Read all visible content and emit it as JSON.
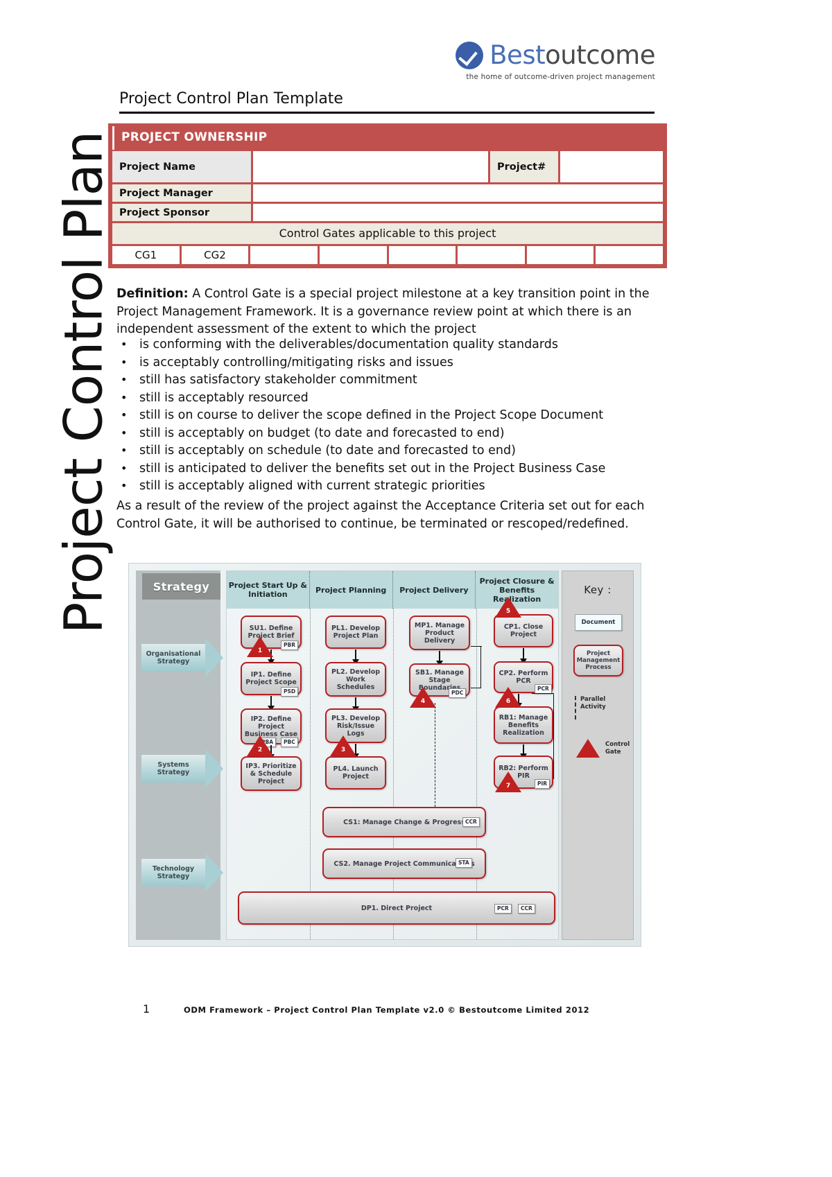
{
  "side_title": "Project Control Plan",
  "logo": {
    "mark": "check-circle-icon",
    "word_first": "Best",
    "word_second": "outcome",
    "tagline": "the home of outcome-driven project management"
  },
  "doc_title": "Project Control Plan Template",
  "ownership": {
    "banner": "PROJECT OWNERSHIP",
    "rows": [
      {
        "label": "Project Name",
        "value": "",
        "label2": "Project#",
        "value2": ""
      },
      {
        "label": "Project Manager",
        "value": ""
      },
      {
        "label": "Project Sponsor",
        "value": ""
      }
    ],
    "gates_caption": "Control Gates applicable to this project",
    "gate_cells": [
      "CG1",
      "CG2",
      "",
      "",
      "",
      "",
      "",
      ""
    ]
  },
  "definition": {
    "lead_label": "Definition:",
    "lead_text": " A Control Gate is a special project milestone at a key transition point in the Project Management Framework. It is a governance review point at which there is an independent assessment of the extent to which the project"
  },
  "bullets": [
    "is conforming with the deliverables/documentation quality standards",
    "is acceptably controlling/mitigating risks and issues",
    "still has satisfactory stakeholder commitment",
    "still is acceptably resourced",
    "still is on course to deliver the scope defined in the Project Scope Document",
    "still is acceptably on budget (to date and forecasted to end)",
    "still is acceptably on schedule (to date and forecasted to end)",
    "still is anticipated to deliver the benefits set out in the Project Business Case",
    "still is acceptably aligned with current strategic priorities"
  ],
  "closing": "As a result of the review of the project against the Acceptance Criteria set out for each Control Gate, it will be authorised to continue, be terminated or rescoped/redefined.",
  "diagram": {
    "strategy_header": "Strategy",
    "strategy_lanes": [
      "Organisational Strategy",
      "Systems Strategy",
      "Technology Strategy"
    ],
    "columns": [
      "Project Start Up & Initiation",
      "Project Planning",
      "Project Delivery",
      "Project Closure & Benefits Realization"
    ],
    "boxes": {
      "su1": "SU1. Define Project Brief",
      "ip1": "IP1. Define Project Scope",
      "ip2": "IP2. Define Project Business Case",
      "ip3": "IP3. Prioritize & Schedule Project",
      "pl1": "PL1. Develop Project Plan",
      "pl2": "PL2. Develop Work Schedules",
      "pl3": "PL3. Develop Risk/Issue Logs",
      "pl4": "PL4. Launch Project",
      "mp1": "MP1. Manage Product Delivery",
      "sb1": "SB1. Manage Stage Boundaries",
      "cp1": "CP1. Close Project",
      "cp2": "CP2. Perform PCR",
      "rb1": "RB1: Manage Benefits Realization",
      "rb2": "RB2: Perform PIR",
      "cs1": "CS1: Manage Change & Progress",
      "cs2": "CS2. Manage Project Communications",
      "dp1": "DP1. Direct Project"
    },
    "doc_tags": {
      "pbr": "PBR",
      "psd": "PSD",
      "pba": "PBA",
      "pbc": "PBC",
      "pdc": "PDC",
      "pcr": "PCR",
      "pir": "PIR",
      "ccr": "CCR",
      "sta": "STA",
      "dp_pcr": "PCR",
      "dp_ccr": "CCR"
    },
    "gates": [
      "1",
      "2",
      "3",
      "4",
      "5",
      "6",
      "7"
    ],
    "key": {
      "title": "Key :",
      "document": "Document",
      "process": "Project Management Process",
      "parallel": "Parallel Activity",
      "control_gate": "Control Gate"
    }
  },
  "footer": {
    "page": "1",
    "text": "ODM Framework – Project Control Plan Template v2.0 © Bestoutcome Limited 2012"
  },
  "colors": {
    "accent_red": "#c0504d",
    "gate_red": "#c0201f",
    "box_border": "#b31f24",
    "header_teal": "#bcd9db",
    "logo_blue": "#4a6fb5"
  }
}
